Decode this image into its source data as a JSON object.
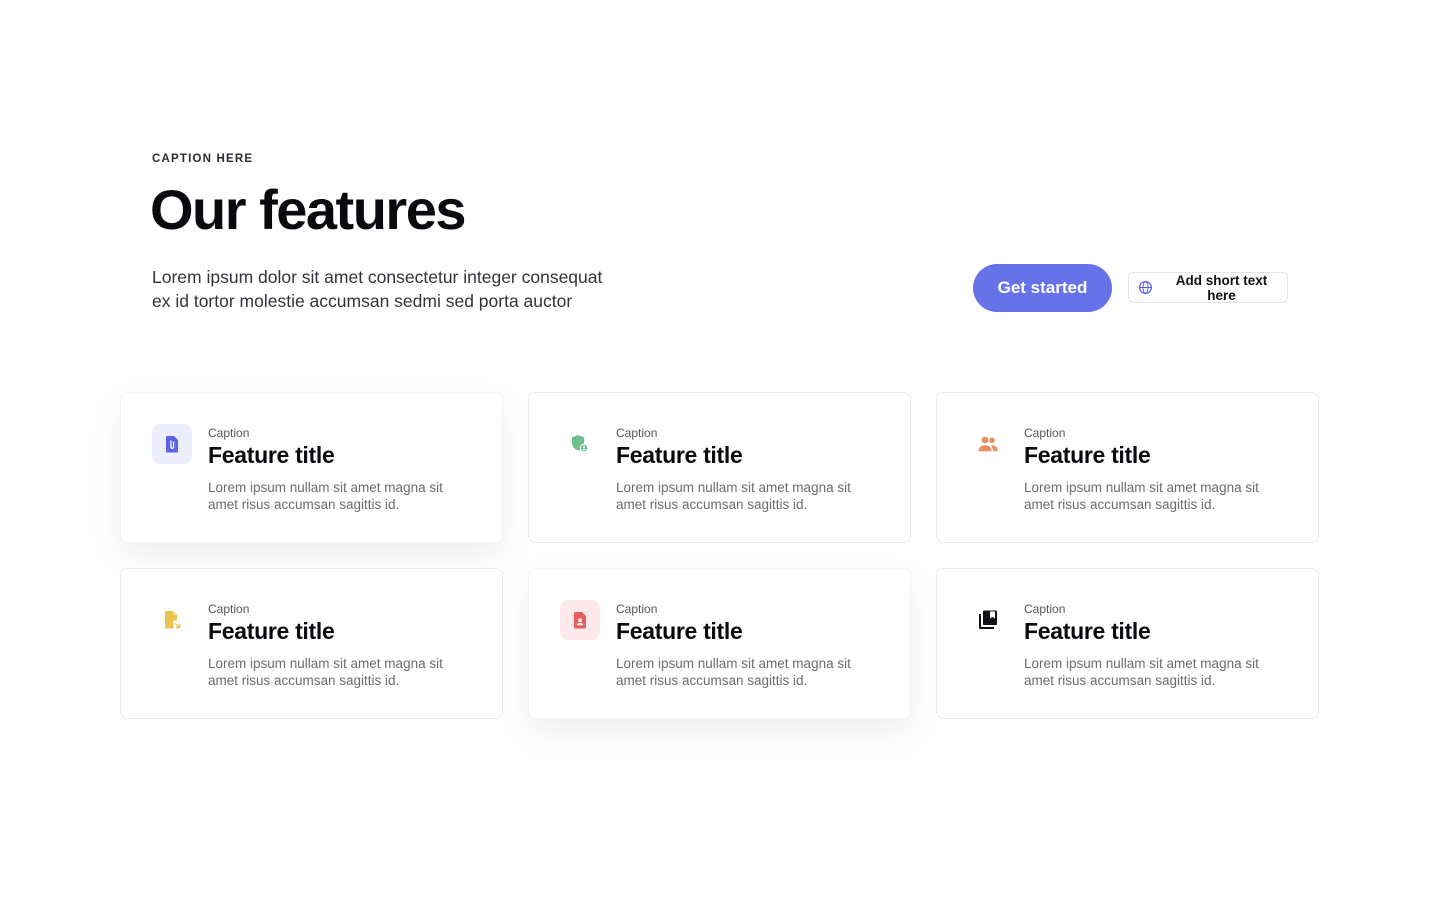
{
  "header": {
    "caption": "CAPTION HERE",
    "title": "Our features",
    "intro_line1": "Lorem ipsum dolor sit amet consectetur integer consequat",
    "intro_line2": "ex id tortor molestie accumsan sedmi sed porta auctor"
  },
  "actions": {
    "primary_label": "Get started",
    "secondary_label": "Add short text here",
    "secondary_icon": "globe-icon"
  },
  "colors": {
    "accent": "#6672e8",
    "icon_blue": "#5b63e6",
    "icon_green": "#6fbf8e",
    "icon_orange": "#e68f5c",
    "icon_yellow": "#e9c44a",
    "icon_red": "#e85d5d",
    "icon_dark": "#111116"
  },
  "features": [
    {
      "caption": "Caption",
      "title": "Feature title",
      "desc_line1": "Lorem ipsum nullam sit amet magna sit",
      "desc_line2": "amet risus accumsan sagittis id.",
      "icon": "file-attachment-icon"
    },
    {
      "caption": "Caption",
      "title": "Feature title",
      "desc_line1": "Lorem ipsum nullam sit amet magna sit",
      "desc_line2": "amet risus accumsan sagittis id.",
      "icon": "shield-user-icon"
    },
    {
      "caption": "Caption",
      "title": "Feature title",
      "desc_line1": "Lorem ipsum nullam sit amet magna sit",
      "desc_line2": "amet risus accumsan sagittis id.",
      "icon": "people-icon"
    },
    {
      "caption": "Caption",
      "title": "Feature title",
      "desc_line1": "Lorem ipsum nullam sit amet magna sit",
      "desc_line2": "amet risus accumsan sagittis id.",
      "icon": "file-export-icon"
    },
    {
      "caption": "Caption",
      "title": "Feature title",
      "desc_line1": "Lorem ipsum nullam sit amet magna sit",
      "desc_line2": "amet risus accumsan sagittis id.",
      "icon": "document-person-icon"
    },
    {
      "caption": "Caption",
      "title": "Feature title",
      "desc_line1": "Lorem ipsum nullam sit amet magna sit",
      "desc_line2": "amet risus accumsan sagittis id.",
      "icon": "library-bookmark-icon"
    }
  ]
}
